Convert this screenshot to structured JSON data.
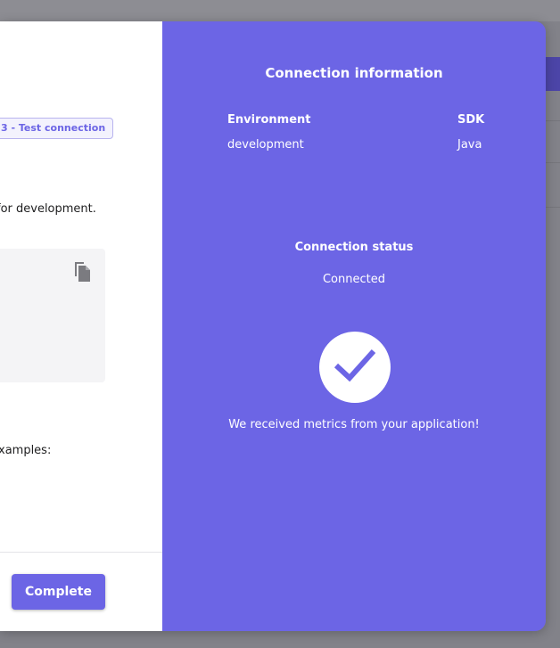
{
  "left": {
    "step_badge": "3 - Test connection",
    "dev_text": "for development.",
    "examples_text": "xamples:",
    "complete_button": "Complete"
  },
  "right": {
    "title": "Connection information",
    "environment_label": "Environment",
    "environment_value": "development",
    "sdk_label": "SDK",
    "sdk_value": "Java",
    "status_label": "Connection status",
    "status_value": "Connected",
    "metrics_message": "We received metrics from your application!"
  },
  "colors": {
    "accent": "#6c65e5",
    "white": "#ffffff"
  },
  "icons": {
    "copy": "copy-icon",
    "check": "check-icon"
  }
}
